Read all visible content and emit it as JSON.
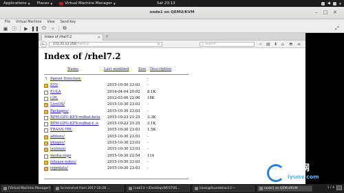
{
  "topbar": {
    "applications": "Applications",
    "places": "Places",
    "app_name": "Virtual Machine Manager",
    "clock": "Sat 23:13"
  },
  "vm_window": {
    "title": "node1 on QEMU/KVM",
    "menu": [
      "File",
      "Virtual Machine",
      "View",
      "Send Key"
    ]
  },
  "browser": {
    "tab_title": "Index of /rhel7.2",
    "url_domain": "172.25.12.250",
    "url_path": "/rhel7.2/",
    "search_placeholder": "Search"
  },
  "listing": {
    "heading": "Index of /rhel7.2",
    "columns": {
      "name": "Name",
      "modified": "Last modified",
      "size": "Size",
      "description": "Description"
    },
    "rows": [
      {
        "name": "Parent Directory",
        "date": "",
        "size": "-",
        "icon": "back"
      },
      {
        "name": "EFI/",
        "date": "2015-10-30 23:03",
        "size": "-",
        "icon": "folder"
      },
      {
        "name": "EULA",
        "date": "2014-04-04 20:02",
        "size": "8.1K",
        "icon": "file"
      },
      {
        "name": "GPL",
        "date": "2012-03-06 22:06",
        "size": "18K",
        "icon": "file"
      },
      {
        "name": "LiveOS/",
        "date": "2015-10-30 23:03",
        "size": "-",
        "icon": "folder"
      },
      {
        "name": "Packages/",
        "date": "2015-10-30 23:03",
        "size": "-",
        "icon": "folder"
      },
      {
        "name": "RPM-GPG-KEY-redhat-beta",
        "date": "2015-10-23 21:25",
        "size": "3.3K",
        "icon": "file"
      },
      {
        "name": "RPM-GPG-KEY-redhat-r..>",
        "date": "2015-10-23 21:25",
        "size": "3.1K",
        "icon": "file"
      },
      {
        "name": "TRANS.TBL",
        "date": "2015-10-30 23:03",
        "size": "1.5K",
        "icon": "file"
      },
      {
        "name": "addons/",
        "date": "2015-10-30 23:03",
        "size": "-",
        "icon": "folder"
      },
      {
        "name": "images/",
        "date": "2015-10-30 23:03",
        "size": "-",
        "icon": "folder"
      },
      {
        "name": "isolinux/",
        "date": "2015-10-30 23:03",
        "size": "-",
        "icon": "folder"
      },
      {
        "name": "media.repo",
        "date": "2015-10-30 22:54",
        "size": "114",
        "icon": "file"
      },
      {
        "name": "release-notes/",
        "date": "2015-10-30 23:03",
        "size": "-",
        "icon": "folder"
      },
      {
        "name": "repodata/",
        "date": "2015-10-30 23:03",
        "size": "-",
        "icon": "folder"
      }
    ]
  },
  "taskbar": {
    "tasks": [
      "[Virtual Machine Manager]",
      "Screenshot from 2017-10-28 ...",
      "[xab13:~/Desktop/WESTOS...",
      "kiosk@foundation12:~",
      "node1 on QEMU/KVM"
    ],
    "pager": "1 / 4"
  },
  "watermark": {
    "title": "运维网",
    "subtitle": "iyunv.com"
  }
}
